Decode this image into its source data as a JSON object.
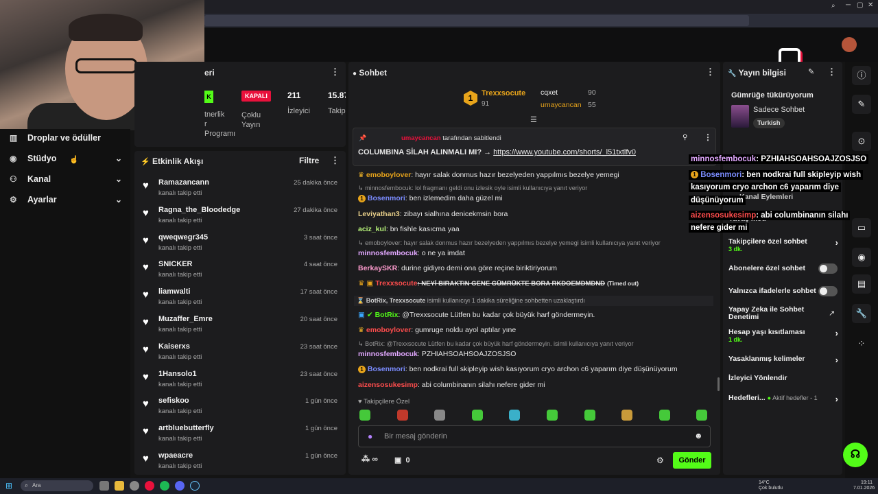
{
  "sidebar": {
    "items": [
      {
        "label": "Droplar ve ödüller",
        "icon": "gift-icon"
      },
      {
        "label": "Stüdyo",
        "icon": "studio-icon"
      },
      {
        "label": "Kanal",
        "icon": "channel-icon"
      },
      {
        "label": "Ayarlar",
        "icon": "gear-icon"
      }
    ]
  },
  "stats_panel": {
    "title": "eri",
    "status_badge": "KAPALI",
    "tag_left": "K",
    "partner_lines": [
      "tnerlik",
      "r",
      "Programı"
    ],
    "multi_stream": [
      "Çoklu",
      "Yayın"
    ],
    "viewers_value": "211",
    "viewers_label": "İzleyici",
    "followers_value": "15.87",
    "followers_label": "Takip"
  },
  "activity": {
    "title": "Etkinlik Akışı",
    "filter_label": "Filtre",
    "items": [
      {
        "name": "Ramazancann",
        "sub": "kanalı takip etti",
        "time": "25 dakika önce"
      },
      {
        "name": "Ragna_the_Bloodedge",
        "sub": "kanalı takip etti",
        "time": "27 dakika önce"
      },
      {
        "name": "qweqwegr345",
        "sub": "kanalı takip etti",
        "time": "3 saat önce"
      },
      {
        "name": "SNICKER",
        "sub": "kanalı takip etti",
        "time": "4 saat önce"
      },
      {
        "name": "liamwalti",
        "sub": "kanalı takip etti",
        "time": "17 saat önce"
      },
      {
        "name": "Muzaffer_Emre",
        "sub": "kanalı takip etti",
        "time": "20 saat önce"
      },
      {
        "name": "Kaiserxs",
        "sub": "kanalı takip etti",
        "time": "23 saat önce"
      },
      {
        "name": "1Hansolo1",
        "sub": "kanalı takip etti",
        "time": "23 saat önce"
      },
      {
        "name": "sefiskoo",
        "sub": "kanalı takip etti",
        "time": "1 gün önce"
      },
      {
        "name": "artbluebutterfly",
        "sub": "kanalı takip etti",
        "time": "1 gün önce"
      },
      {
        "name": "wpaeacre",
        "sub": "kanalı takip etti",
        "time": "1 gün önce"
      }
    ]
  },
  "chat": {
    "title": "Sohbet",
    "leaderboard": {
      "first_name": "Trexxsocute",
      "first_score": "91",
      "second_name": "cqxet",
      "second_score": "90",
      "third_name": "umaycancan",
      "third_score": "55"
    },
    "pinned": {
      "by_user": "umaycancan",
      "by_text": "tarafından sabitlendi",
      "text": "COLUMBINA SİLAH ALINMALI MI? →",
      "link": "https://www.youtube.com/shorts/_l51txtlfv0"
    },
    "messages": [
      {
        "user": "emoboylover",
        "text": ": hayır salak donmus hazır bezelyeden yappılmıs bezelye yemegi",
        "color": "#e8a41b"
      },
      {
        "reply": "minnosfembocuk: lol fragmanı geldi onu izlesik oyle isimli kullanıcıya yanıt veriyor"
      },
      {
        "user": "Bosenmori",
        "text": ": ben izlemedim daha güzel mi",
        "color": "#7b8cff"
      },
      {
        "user": "Leviyathan3",
        "text": ": zibayı sialhına denicekmsin bora",
        "color": "#e9d08a"
      },
      {
        "user": "aciz_kul",
        "text": ": bn fishle kasıcma yaa",
        "color": "#b7f27a"
      },
      {
        "reply": "emoboylover: hayır salak donmus hazır bezelyeden yappılmıs bezelye yemegi isimli kullanıcıya yanıt veriyor"
      },
      {
        "user": "minnosfembocuk",
        "text": ": o ne ya imdat",
        "color": "#e2a8ff"
      },
      {
        "user": "BerkaySKR",
        "text": ": durine gidiyro demi ona göre reçine biriktiriyorum",
        "color": "#ff9ccf"
      },
      {
        "user": "Trexxsocute",
        "text": ": NEYİ BIRAKTIN GENE GÜMRÜKTE BORA RKDOEMDMDND",
        "extra": "(Timed out)",
        "color": "#ff4d4d"
      },
      {
        "system": "BotRix, Trexxsocute",
        "text": "isimli kullanıcıyı 1 dakika süreliğine sohbetten uzaklaştırdı"
      },
      {
        "user": "BotRix",
        "text": ": @Trexxsocute Lütfen bu kadar çok büyük harf göndermeyin.",
        "color": "#53fc18"
      },
      {
        "user": "emoboylover",
        "text": ": gumruge noldu ayol aptılar yıne",
        "color": "#ff4d4d"
      },
      {
        "reply": "BotRix: @Trexxsocute Lütfen bu kadar çok büyük harf göndermeyin. isimli kullanıcıya yanıt veriyor"
      },
      {
        "user": "minnosfembocuk",
        "text": ": PZHIAHSOAHSOAJZOSJSO",
        "color": "#e2a8ff"
      },
      {
        "user": "Bosenmori",
        "text": ": ben nodkrai full skipleyip wish kasıyorum cryo archon c6 yaparım diye düşünüyorum",
        "color": "#7b8cff"
      },
      {
        "user": "aizensosukesimp",
        "text": ": abi columbinanın silahı nefere gider mi",
        "color": "#ff4d4d"
      }
    ],
    "followers_only": "Takipçilere Özel",
    "input_placeholder": "Bir mesaj gönderin",
    "infinity": "∞",
    "counter": "0",
    "send_label": "Gönder"
  },
  "stream_info": {
    "title": "Yayın bilgisi",
    "stream_title": "Gümrüğe tükürüyorum",
    "category": "Sadece Sohbet",
    "language": "Turkish",
    "section_partial": "Kanal Eylemleri",
    "slow_mode_partial": "Yavaş mod",
    "followers_chat": "Takipçilere özel sohbet",
    "followers_chat_sub": "3 dk.",
    "subs_chat": "Abonelere özel sohbet",
    "emotes_chat": "Yalnızca ifadelerle sohbet",
    "ai_mod": "Yapay Zeka ile Sohbet Denetimi",
    "account_age": "Hesap yaşı kısıtlaması",
    "account_age_sub": "1 dk.",
    "banned_words": "Yasaklanmış kelimeler",
    "raid": "İzleyici Yönlendir",
    "goals": "Hedefleri...",
    "goals_sub": "Aktif hedefler - 1"
  },
  "overlay": {
    "lines": [
      {
        "user": "minnosfembocuk",
        "text": ": PZHIAHSOAHSOAJZOSJSO"
      },
      {
        "user": "Bosenmori",
        "text": ": ben nodkrai full skipleyip wish"
      },
      {
        "text": "kasıyorum cryo archon c6 yaparım diye"
      },
      {
        "text": "düşünüyorum"
      },
      {
        "user": "aizensosukesimp",
        "text": ": abi columbinanın silahı"
      },
      {
        "text": "nefere gider mi"
      }
    ]
  },
  "taskbar": {
    "search_placeholder": "Ara",
    "weather_temp": "14°C",
    "weather_text": "Çok bulutlu",
    "time": "19:11",
    "date": "7.01.2026"
  },
  "colors": {
    "accent": "#53fc18",
    "danger": "#e9113c",
    "gold": "#e8a41b"
  }
}
